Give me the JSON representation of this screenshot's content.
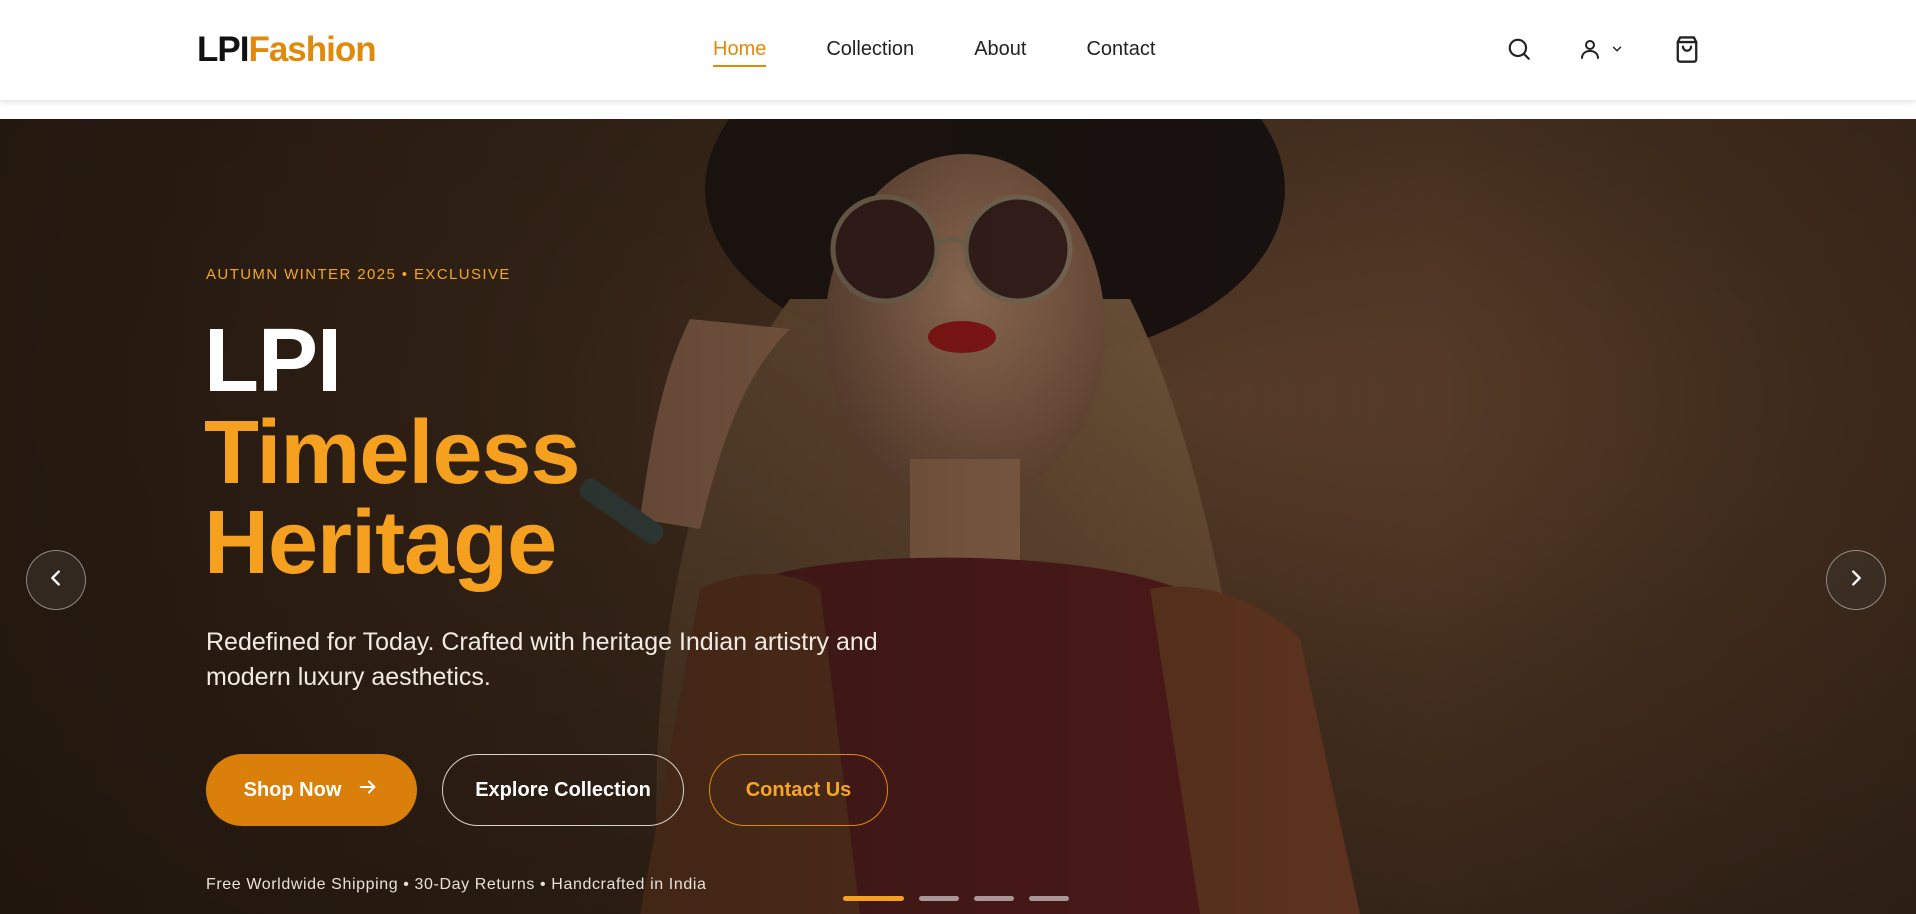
{
  "brand": {
    "part1": "LPI",
    "part2": "Fashion"
  },
  "nav": {
    "items": [
      {
        "label": "Home",
        "active": true
      },
      {
        "label": "Collection",
        "active": false
      },
      {
        "label": "About",
        "active": false
      },
      {
        "label": "Contact",
        "active": false
      }
    ]
  },
  "header_icons": [
    "search-icon",
    "user-icon",
    "chevron-down-icon",
    "shopping-bag-icon"
  ],
  "hero": {
    "eyebrow": "AUTUMN WINTER 2025 • EXCLUSIVE",
    "title_line1": "LPI",
    "title_line2": "Timeless",
    "title_line3": "Heritage",
    "subtitle": "Redefined for Today. Crafted with heritage Indian artistry and modern luxury aesthetics.",
    "buttons": {
      "shop": "Shop Now",
      "explore": "Explore Collection",
      "contact": "Contact Us"
    },
    "footnote": "Free Worldwide Shipping • 30-Day Returns • Handcrafted in India",
    "slides": {
      "count": 4,
      "active_index": 0
    }
  },
  "colors": {
    "accent": "#E08A0B",
    "accent_light": "#F5A623",
    "text_dark": "#111111"
  }
}
